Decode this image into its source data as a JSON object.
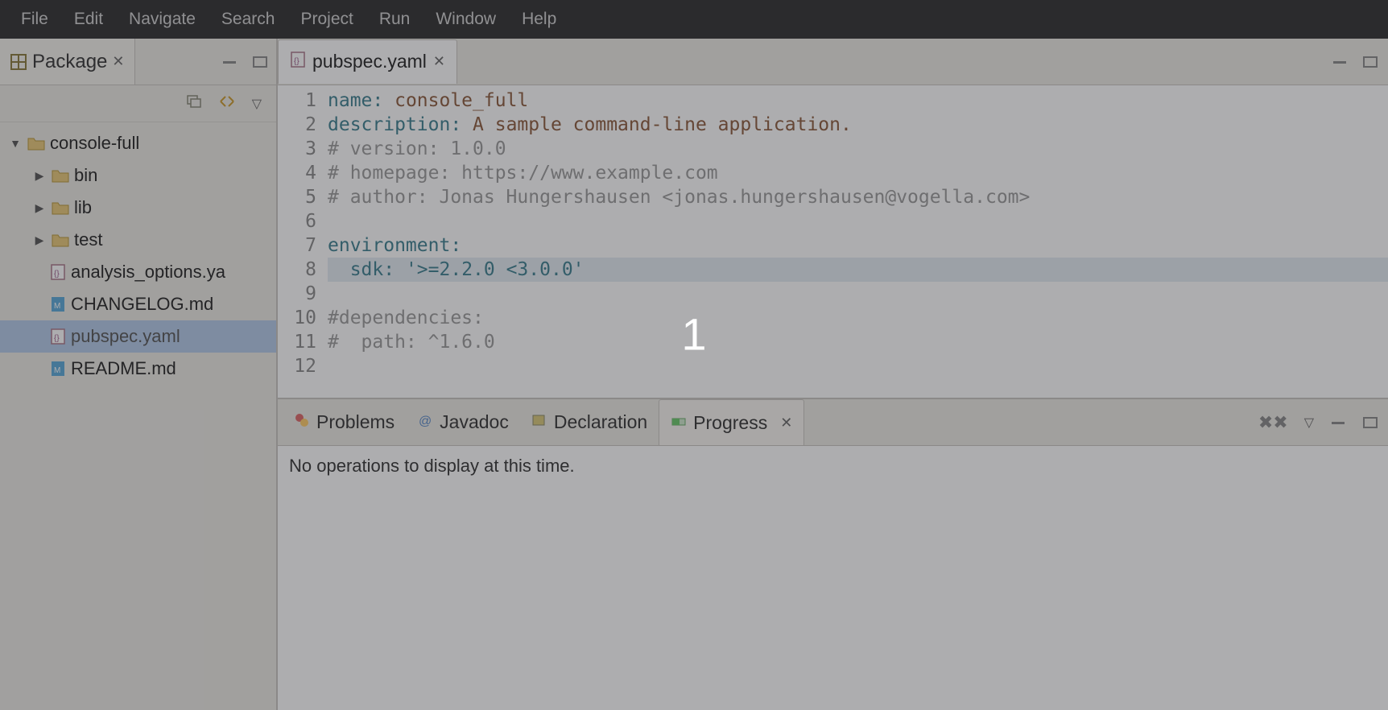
{
  "menubar": [
    "File",
    "Edit",
    "Navigate",
    "Search",
    "Project",
    "Run",
    "Window",
    "Help"
  ],
  "overlay_number": "1",
  "package_view": {
    "title": "Package",
    "project": "console-full",
    "folders": [
      "bin",
      "lib",
      "test"
    ],
    "files": [
      {
        "name": "analysis_options.ya",
        "icon": "yaml"
      },
      {
        "name": "CHANGELOG.md",
        "icon": "md"
      },
      {
        "name": "pubspec.yaml",
        "icon": "yaml",
        "selected": true
      },
      {
        "name": "README.md",
        "icon": "md"
      }
    ]
  },
  "editor": {
    "tab_label": "pubspec.yaml",
    "lines": [
      {
        "n": "1",
        "segs": [
          {
            "t": "name",
            "c": "key"
          },
          {
            "t": ": ",
            "c": "key"
          },
          {
            "t": "console_full",
            "c": "txt"
          }
        ]
      },
      {
        "n": "2",
        "segs": [
          {
            "t": "description",
            "c": "key"
          },
          {
            "t": ": ",
            "c": "key"
          },
          {
            "t": "A sample command-line application.",
            "c": "txt"
          }
        ]
      },
      {
        "n": "3",
        "segs": [
          {
            "t": "# version: 1.0.0",
            "c": "cmt"
          }
        ]
      },
      {
        "n": "4",
        "segs": [
          {
            "t": "# homepage: https://www.example.com",
            "c": "cmt"
          }
        ]
      },
      {
        "n": "5",
        "segs": [
          {
            "t": "# author: Jonas Hungershausen <jonas.hungershausen@vogella.com>",
            "c": "cmt"
          }
        ]
      },
      {
        "n": "6",
        "segs": [
          {
            "t": "",
            "c": "txt"
          }
        ]
      },
      {
        "n": "7",
        "segs": [
          {
            "t": "environment",
            "c": "key"
          },
          {
            "t": ":",
            "c": "key"
          }
        ]
      },
      {
        "n": "8",
        "hl": true,
        "segs": [
          {
            "t": "  ",
            "c": "txt"
          },
          {
            "t": "sdk",
            "c": "key"
          },
          {
            "t": ": ",
            "c": "key"
          },
          {
            "t": "'>=2.2.0 <3.0.0'",
            "c": "str"
          }
        ]
      },
      {
        "n": "9",
        "segs": [
          {
            "t": "",
            "c": "txt"
          }
        ]
      },
      {
        "n": "10",
        "segs": [
          {
            "t": "#dependencies:",
            "c": "cmt"
          }
        ]
      },
      {
        "n": "11",
        "segs": [
          {
            "t": "#  path: ^1.6.0",
            "c": "cmt"
          }
        ]
      },
      {
        "n": "12",
        "segs": [
          {
            "t": "",
            "c": "txt"
          }
        ]
      }
    ]
  },
  "bottom": {
    "tabs": [
      "Problems",
      "Javadoc",
      "Declaration",
      "Progress"
    ],
    "active_tab": "Progress",
    "content": "No operations to display at this time."
  }
}
